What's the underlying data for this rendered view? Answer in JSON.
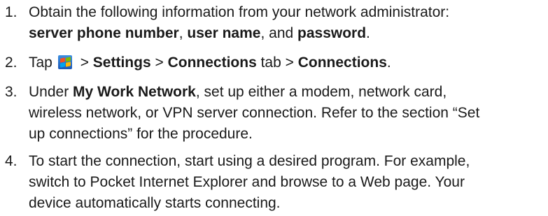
{
  "steps": [
    {
      "number": "1.",
      "lines": [
        "Obtain the following information from your network administrator:",
        [
          "server phone number",
          ", ",
          "user name",
          ", and ",
          "password",
          "."
        ]
      ]
    },
    {
      "number": "2.",
      "parts": [
        "Tap",
        " > ",
        "Settings",
        " > ",
        "Connections",
        " tab > ",
        "Connections",
        "."
      ],
      "icon": "windows-start-icon"
    },
    {
      "number": "3.",
      "lines": [
        [
          "Under ",
          "My Work Network",
          ", set up either a modem, network card,"
        ],
        "wireless network, or VPN server connection. Refer to the section “Set",
        "up connections” for the procedure."
      ]
    },
    {
      "number": "4.",
      "lines": [
        "To start the connection, start using a desired program. For example,",
        "switch to Pocket Internet Explorer and browse to a Web page. Your",
        "device automatically starts connecting."
      ]
    }
  ]
}
